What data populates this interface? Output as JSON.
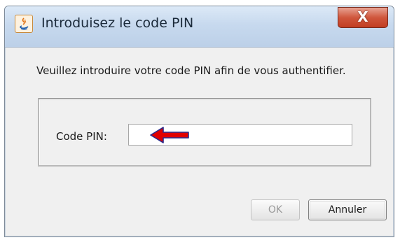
{
  "window": {
    "title": "Introduisez le code PIN",
    "close_label": "X"
  },
  "message": "Veuillez introduire votre code PIN afin de vous authentifier.",
  "pin": {
    "label": "Code PIN:",
    "value": "",
    "placeholder": ""
  },
  "buttons": {
    "ok_label": "OK",
    "cancel_label": "Annuler"
  },
  "icons": {
    "app": "java-app-icon",
    "close": "close-icon",
    "pointer": "red-arrow-icon"
  },
  "colors": {
    "arrow": "#e00000",
    "close_button": "#c94a30"
  }
}
